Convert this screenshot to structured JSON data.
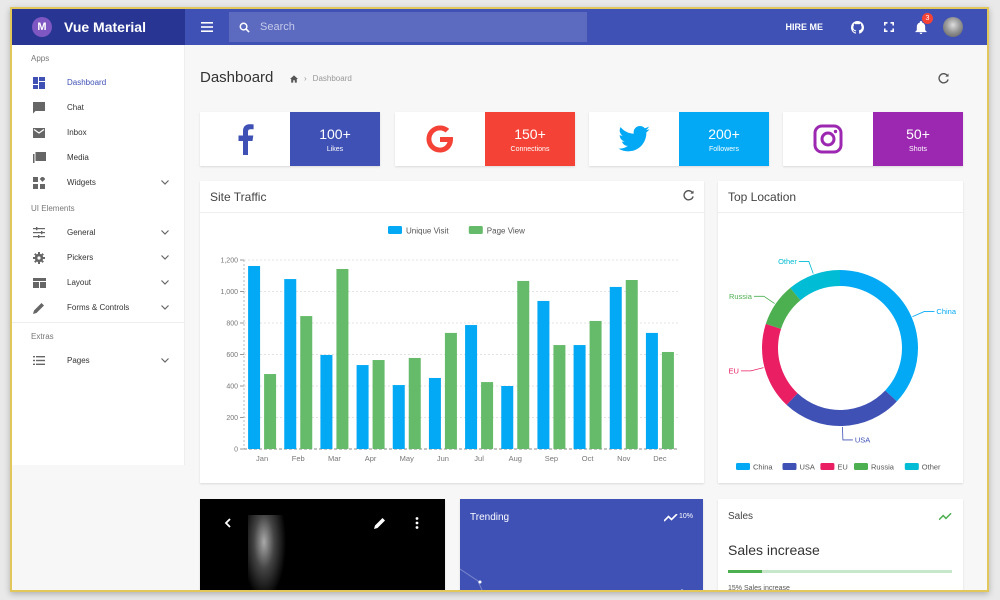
{
  "app": {
    "title": "Vue Material",
    "logo_letter": "M"
  },
  "topbar": {
    "search_placeholder": "Search",
    "hire_me": "HIRE ME",
    "notification_count": "3",
    "icons": [
      "menu-icon",
      "search-icon",
      "github-icon",
      "fullscreen-icon",
      "bell-icon",
      "avatar"
    ]
  },
  "sidebar": {
    "sections": [
      {
        "label": "Apps",
        "items": [
          {
            "label": "Dashboard",
            "icon": "dashboard-icon",
            "active": true,
            "expandable": false
          },
          {
            "label": "Chat",
            "icon": "chat-icon",
            "active": false,
            "expandable": false
          },
          {
            "label": "Inbox",
            "icon": "mail-icon",
            "active": false,
            "expandable": false
          },
          {
            "label": "Media",
            "icon": "media-icon",
            "active": false,
            "expandable": false
          },
          {
            "label": "Widgets",
            "icon": "widgets-icon",
            "active": false,
            "expandable": true
          }
        ]
      },
      {
        "label": "UI Elements",
        "items": [
          {
            "label": "General",
            "icon": "tune-icon",
            "active": false,
            "expandable": true
          },
          {
            "label": "Pickers",
            "icon": "gear-icon",
            "active": false,
            "expandable": true
          },
          {
            "label": "Layout",
            "icon": "layout-icon",
            "active": false,
            "expandable": true
          },
          {
            "label": "Forms & Controls",
            "icon": "pencil-icon",
            "active": false,
            "expandable": true
          }
        ]
      },
      {
        "label": "Extras",
        "items": [
          {
            "label": "Pages",
            "icon": "list-icon",
            "active": false,
            "expandable": true
          }
        ]
      }
    ]
  },
  "page": {
    "title": "Dashboard",
    "breadcrumb": [
      "home-icon",
      "Dashboard"
    ]
  },
  "social": [
    {
      "name": "facebook",
      "value": "100+",
      "label": "Likes",
      "color": "#3f51b5"
    },
    {
      "name": "google",
      "value": "150+",
      "label": "Connections",
      "color": "#f44336"
    },
    {
      "name": "twitter",
      "value": "200+",
      "label": "Followers",
      "color": "#03a9f4"
    },
    {
      "name": "instagram",
      "value": "50+",
      "label": "Shots",
      "color": "#9c27b0"
    }
  ],
  "site_traffic": {
    "title": "Site Traffic"
  },
  "top_location": {
    "title": "Top Location"
  },
  "trending": {
    "title": "Trending",
    "percent": "10%",
    "color": "#3f51b5"
  },
  "sales": {
    "title": "Sales",
    "headline": "Sales increase",
    "progress": 15,
    "caption": "15% Sales increase"
  },
  "chart_data": [
    {
      "type": "bar",
      "title": "Site Traffic",
      "categories": [
        "Jan",
        "Feb",
        "Mar",
        "Apr",
        "May",
        "Jun",
        "Jul",
        "Aug",
        "Sep",
        "Oct",
        "Nov",
        "Dec"
      ],
      "series": [
        {
          "name": "Unique Visit",
          "color": "#03a9f4",
          "values": [
            1162,
            1079,
            597,
            533,
            406,
            451,
            787,
            400,
            940,
            660,
            1029,
            737
          ]
        },
        {
          "name": "Page View",
          "color": "#66bb6a",
          "values": [
            476,
            844,
            1143,
            565,
            578,
            737,
            425,
            1067,
            660,
            813,
            1073,
            616
          ]
        }
      ],
      "yticks": [
        "0",
        "200",
        "400",
        "600",
        "800",
        "1,000",
        "1,200"
      ],
      "ylim": [
        0,
        1200
      ],
      "legend": "top-center",
      "grid": true
    },
    {
      "type": "pie",
      "title": "Top Location",
      "donut": true,
      "slices": [
        {
          "label": "China",
          "value": 37,
          "color": "#03a9f4"
        },
        {
          "label": "USA",
          "value": 25,
          "color": "#3f51b5"
        },
        {
          "label": "EU",
          "value": 18,
          "color": "#e91e63"
        },
        {
          "label": "Russia",
          "value": 9,
          "color": "#4caf50"
        },
        {
          "label": "Other",
          "value": 11,
          "color": "#00bcd4"
        }
      ],
      "legend": "bottom"
    }
  ]
}
